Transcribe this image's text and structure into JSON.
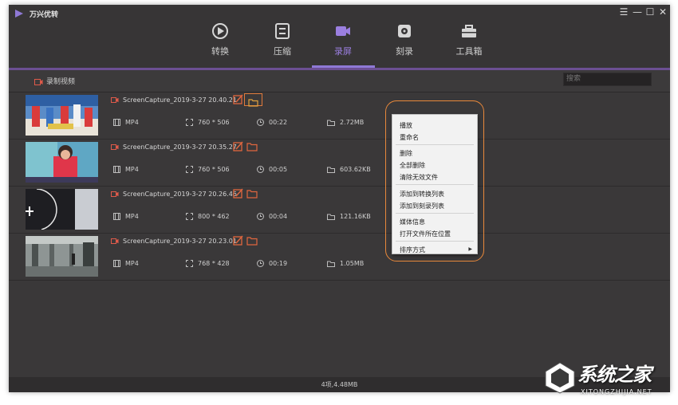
{
  "app": {
    "title": "万兴优转",
    "brand_color": "#8f79d6",
    "window_controls": [
      "menu-icon",
      "minimize-icon",
      "maximize-icon",
      "close-icon"
    ]
  },
  "nav": {
    "items": [
      {
        "label": "转换",
        "icon": "convert-icon",
        "active": false
      },
      {
        "label": "压缩",
        "icon": "compress-icon",
        "active": false
      },
      {
        "label": "录屏",
        "icon": "record-screen-icon",
        "active": true
      },
      {
        "label": "刻录",
        "icon": "burn-disc-icon",
        "active": false
      },
      {
        "label": "工具箱",
        "icon": "toolbox-icon",
        "active": false
      }
    ]
  },
  "subheader": {
    "record_video_label": "录制视频",
    "search_placeholder": "搜索"
  },
  "files": [
    {
      "name": "ScreenCapture_2019-3-27 20.40.21",
      "format": "MP4",
      "resolution": "760 * 506",
      "duration": "00:22",
      "size": "2.72MB"
    },
    {
      "name": "ScreenCapture_2019-3-27 20.35.27",
      "format": "MP4",
      "resolution": "760 * 506",
      "duration": "00:05",
      "size": "603.62KB"
    },
    {
      "name": "ScreenCapture_2019-3-27 20.26.46",
      "format": "MP4",
      "resolution": "800 * 462",
      "duration": "00:04",
      "size": "121.16KB"
    },
    {
      "name": "ScreenCapture_2019-3-27 20.23.01",
      "format": "MP4",
      "resolution": "768 * 428",
      "duration": "00:19",
      "size": "1.05MB"
    }
  ],
  "context_menu": {
    "groups": [
      [
        "播放",
        "重命名"
      ],
      [
        "删除",
        "全部删除",
        "清除无效文件"
      ],
      [
        "添加到转换列表",
        "添加到刻录列表"
      ],
      [
        "媒体信息",
        "打开文件所在位置"
      ],
      [
        "排序方式"
      ]
    ],
    "highlight_color": "#e8883a"
  },
  "status": {
    "summary": "4项,4.48MB"
  },
  "watermark": {
    "text": "系统之家",
    "sub": "XITONGZHIJIA.NET"
  }
}
